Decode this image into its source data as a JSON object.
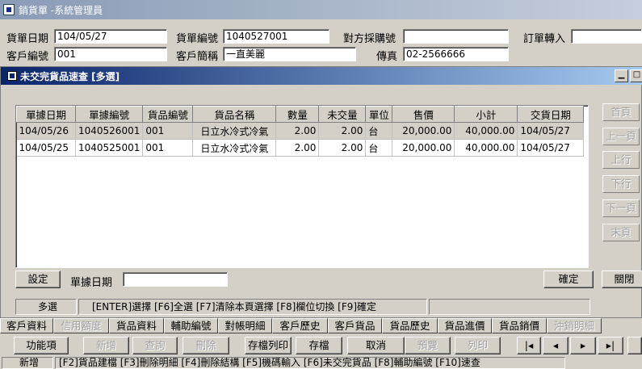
{
  "window": {
    "title": "銷貨單 -系統管理員"
  },
  "header": {
    "sales_date": {
      "label": "貨單日期",
      "value": "104/05/27"
    },
    "sales_no": {
      "label": "貨單編號",
      "value": "1040527001"
    },
    "buyer": {
      "label": "對方採購號",
      "value": ""
    },
    "order_transfer": {
      "label": "訂單轉入",
      "value": ""
    },
    "customer_no": {
      "label": "客戶編號",
      "value": "001"
    },
    "customer_name": {
      "label": "客戶簡稱",
      "value": "一直美麗"
    },
    "fax": {
      "label": "傳真",
      "value": "02-2566666"
    }
  },
  "dialog": {
    "title": "未交完貨品速查 [多選]",
    "columns": [
      "單據日期",
      "單據編號",
      "貨品編號",
      "貨品名稱",
      "數量",
      "未交量",
      "單位",
      "售價",
      "小計",
      "交貨日期"
    ],
    "rows": [
      [
        "104/05/26",
        "1040526001",
        "001",
        "日立水冷式冷氣",
        "2.00",
        "2.00",
        "台",
        "20,000.00",
        "40,000.00",
        "104/05/27"
      ],
      [
        "104/05/25",
        "1040525001",
        "001",
        "日立水冷式冷氣",
        "2.00",
        "2.00",
        "台",
        "20,000.00",
        "40,000.00",
        "104/05/27"
      ]
    ],
    "nav": [
      "首頁",
      "上一頁",
      "上行",
      "下行",
      "下一頁",
      "末頁"
    ],
    "settings_label": "設定",
    "doc_date_label": "單據日期",
    "doc_date_value": "",
    "ok_label": "確定",
    "close_label": "關閉",
    "status_mode": "多選",
    "status_hint": "[ENTER]選擇 [F6]全選 [F7]清除本頁選擇 [F8]欄位切換 [F9]確定"
  },
  "tabs": [
    {
      "label": "客戶資料",
      "enabled": true
    },
    {
      "label": "信用額度",
      "enabled": false
    },
    {
      "label": "貨品資料",
      "enabled": true
    },
    {
      "label": "輔助編號",
      "enabled": true
    },
    {
      "label": "對帳明細",
      "enabled": true
    },
    {
      "label": "客戶歷史",
      "enabled": true
    },
    {
      "label": "客戶貨品",
      "enabled": true
    },
    {
      "label": "貨品歷史",
      "enabled": true
    },
    {
      "label": "貨品進價",
      "enabled": true
    },
    {
      "label": "貨品銷價",
      "enabled": true
    },
    {
      "label": "沖銷明細",
      "enabled": false
    }
  ],
  "toolbar": {
    "functions": "功能項",
    "add": "新增",
    "query": "查詢",
    "delete": "刪除",
    "save_print": "存檔列印",
    "save": "存檔",
    "cancel": "取消",
    "preview": "預覽",
    "print": "列印"
  },
  "bottom_status": {
    "mode": "新增",
    "hint": "[F2]貨品建檔 [F3]刪除明細 [F4]刪除結構 [F5]機碼輸入 [F6]未交完貨品 [F8]輔助編號 [F10]速查"
  }
}
